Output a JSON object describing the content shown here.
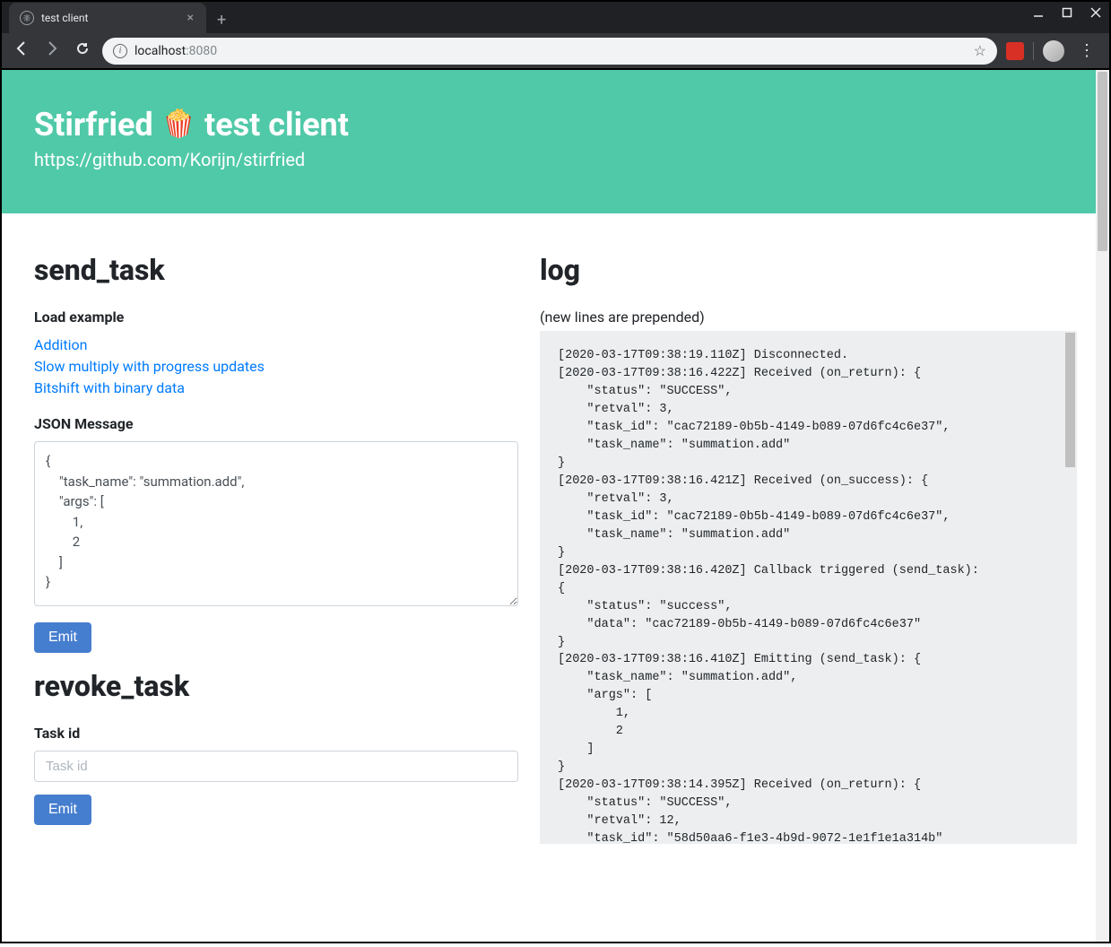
{
  "browser": {
    "tab_title": "test client",
    "url_host": "localhost",
    "url_port": ":8080"
  },
  "header": {
    "title_prefix": "Stirfried",
    "title_suffix": "test client",
    "subtitle": "https://github.com/Korijn/stirfried"
  },
  "send_task": {
    "heading": "send_task",
    "load_example_label": "Load example",
    "examples": [
      "Addition",
      "Slow multiply with progress updates",
      "Bitshift with binary data"
    ],
    "json_label": "JSON Message",
    "json_value": "{\n    \"task_name\": \"summation.add\",\n    \"args\": [\n        1,\n        2\n    ]\n}",
    "emit_label": "Emit"
  },
  "revoke_task": {
    "heading": "revoke_task",
    "task_id_label": "Task id",
    "task_id_placeholder": "Task id",
    "emit_label": "Emit"
  },
  "log": {
    "heading": "log",
    "hint": "(new lines are prepended)",
    "content": "[2020-03-17T09:38:19.110Z] Disconnected.\n[2020-03-17T09:38:16.422Z] Received (on_return): {\n    \"status\": \"SUCCESS\",\n    \"retval\": 3,\n    \"task_id\": \"cac72189-0b5b-4149-b089-07d6fc4c6e37\",\n    \"task_name\": \"summation.add\"\n}\n[2020-03-17T09:38:16.421Z] Received (on_success): {\n    \"retval\": 3,\n    \"task_id\": \"cac72189-0b5b-4149-b089-07d6fc4c6e37\",\n    \"task_name\": \"summation.add\"\n}\n[2020-03-17T09:38:16.420Z] Callback triggered (send_task): \n{\n    \"status\": \"success\",\n    \"data\": \"cac72189-0b5b-4149-b089-07d6fc4c6e37\"\n}\n[2020-03-17T09:38:16.410Z] Emitting (send_task): {\n    \"task_name\": \"summation.add\",\n    \"args\": [\n        1,\n        2\n    ]\n}\n[2020-03-17T09:38:14.395Z] Received (on_return): {\n    \"status\": \"SUCCESS\",\n    \"retval\": 12,\n    \"task_id\": \"58d50aa6-f1e3-4b9d-9072-1e1f1e1a314b\""
  }
}
